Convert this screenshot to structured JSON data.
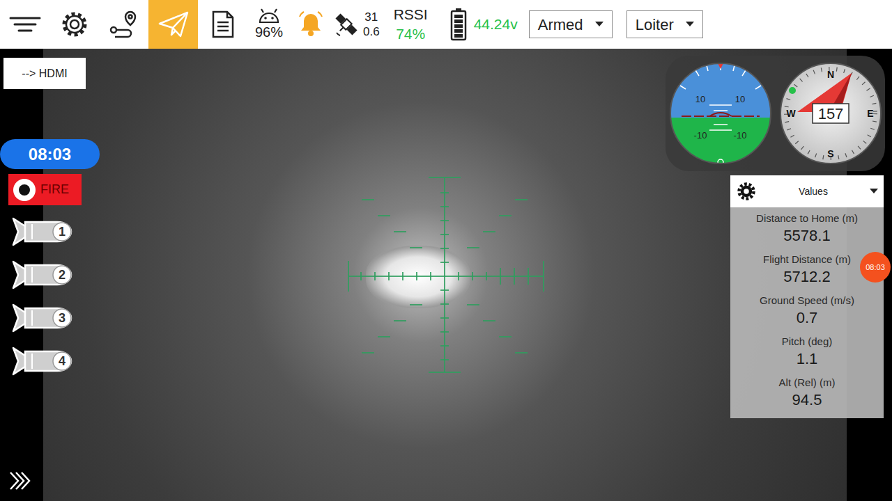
{
  "toolbar": {
    "tabs": [
      {
        "selected": false
      },
      {
        "selected": false
      },
      {
        "selected": false
      },
      {
        "selected": true
      },
      {
        "selected": false
      }
    ],
    "device_battery": "96%",
    "satellites": {
      "count": "31",
      "hdop": "0.6"
    },
    "rssi": {
      "label": "RSSI",
      "value": "74%"
    },
    "battery_voltage": "44.24v",
    "dropdowns": [
      {
        "value": "Armed"
      },
      {
        "value": "Loiter"
      }
    ]
  },
  "hdmi_button": "--> HDMI",
  "timer": "08:03",
  "fire_button": "FIRE",
  "bombs": [
    {
      "label": "1"
    },
    {
      "label": "2"
    },
    {
      "label": "3"
    },
    {
      "label": "4"
    }
  ],
  "attitude": {
    "labels": [
      "10",
      "10",
      "-10",
      "-10"
    ]
  },
  "compass": {
    "cardinals": [
      "N",
      "E",
      "S",
      "W"
    ],
    "heading": "157"
  },
  "values_panel": {
    "title": "Values",
    "rows": [
      {
        "label": "Distance to Home (m)",
        "value": "5578.1"
      },
      {
        "label": "Flight Distance (m)",
        "value": "5712.2"
      },
      {
        "label": "Ground Speed (m/s)",
        "value": "0.7"
      },
      {
        "label": "Pitch (deg)",
        "value": "1.1"
      },
      {
        "label": "Alt (Rel) (m)",
        "value": "94.5"
      }
    ]
  },
  "badge": "08:03"
}
